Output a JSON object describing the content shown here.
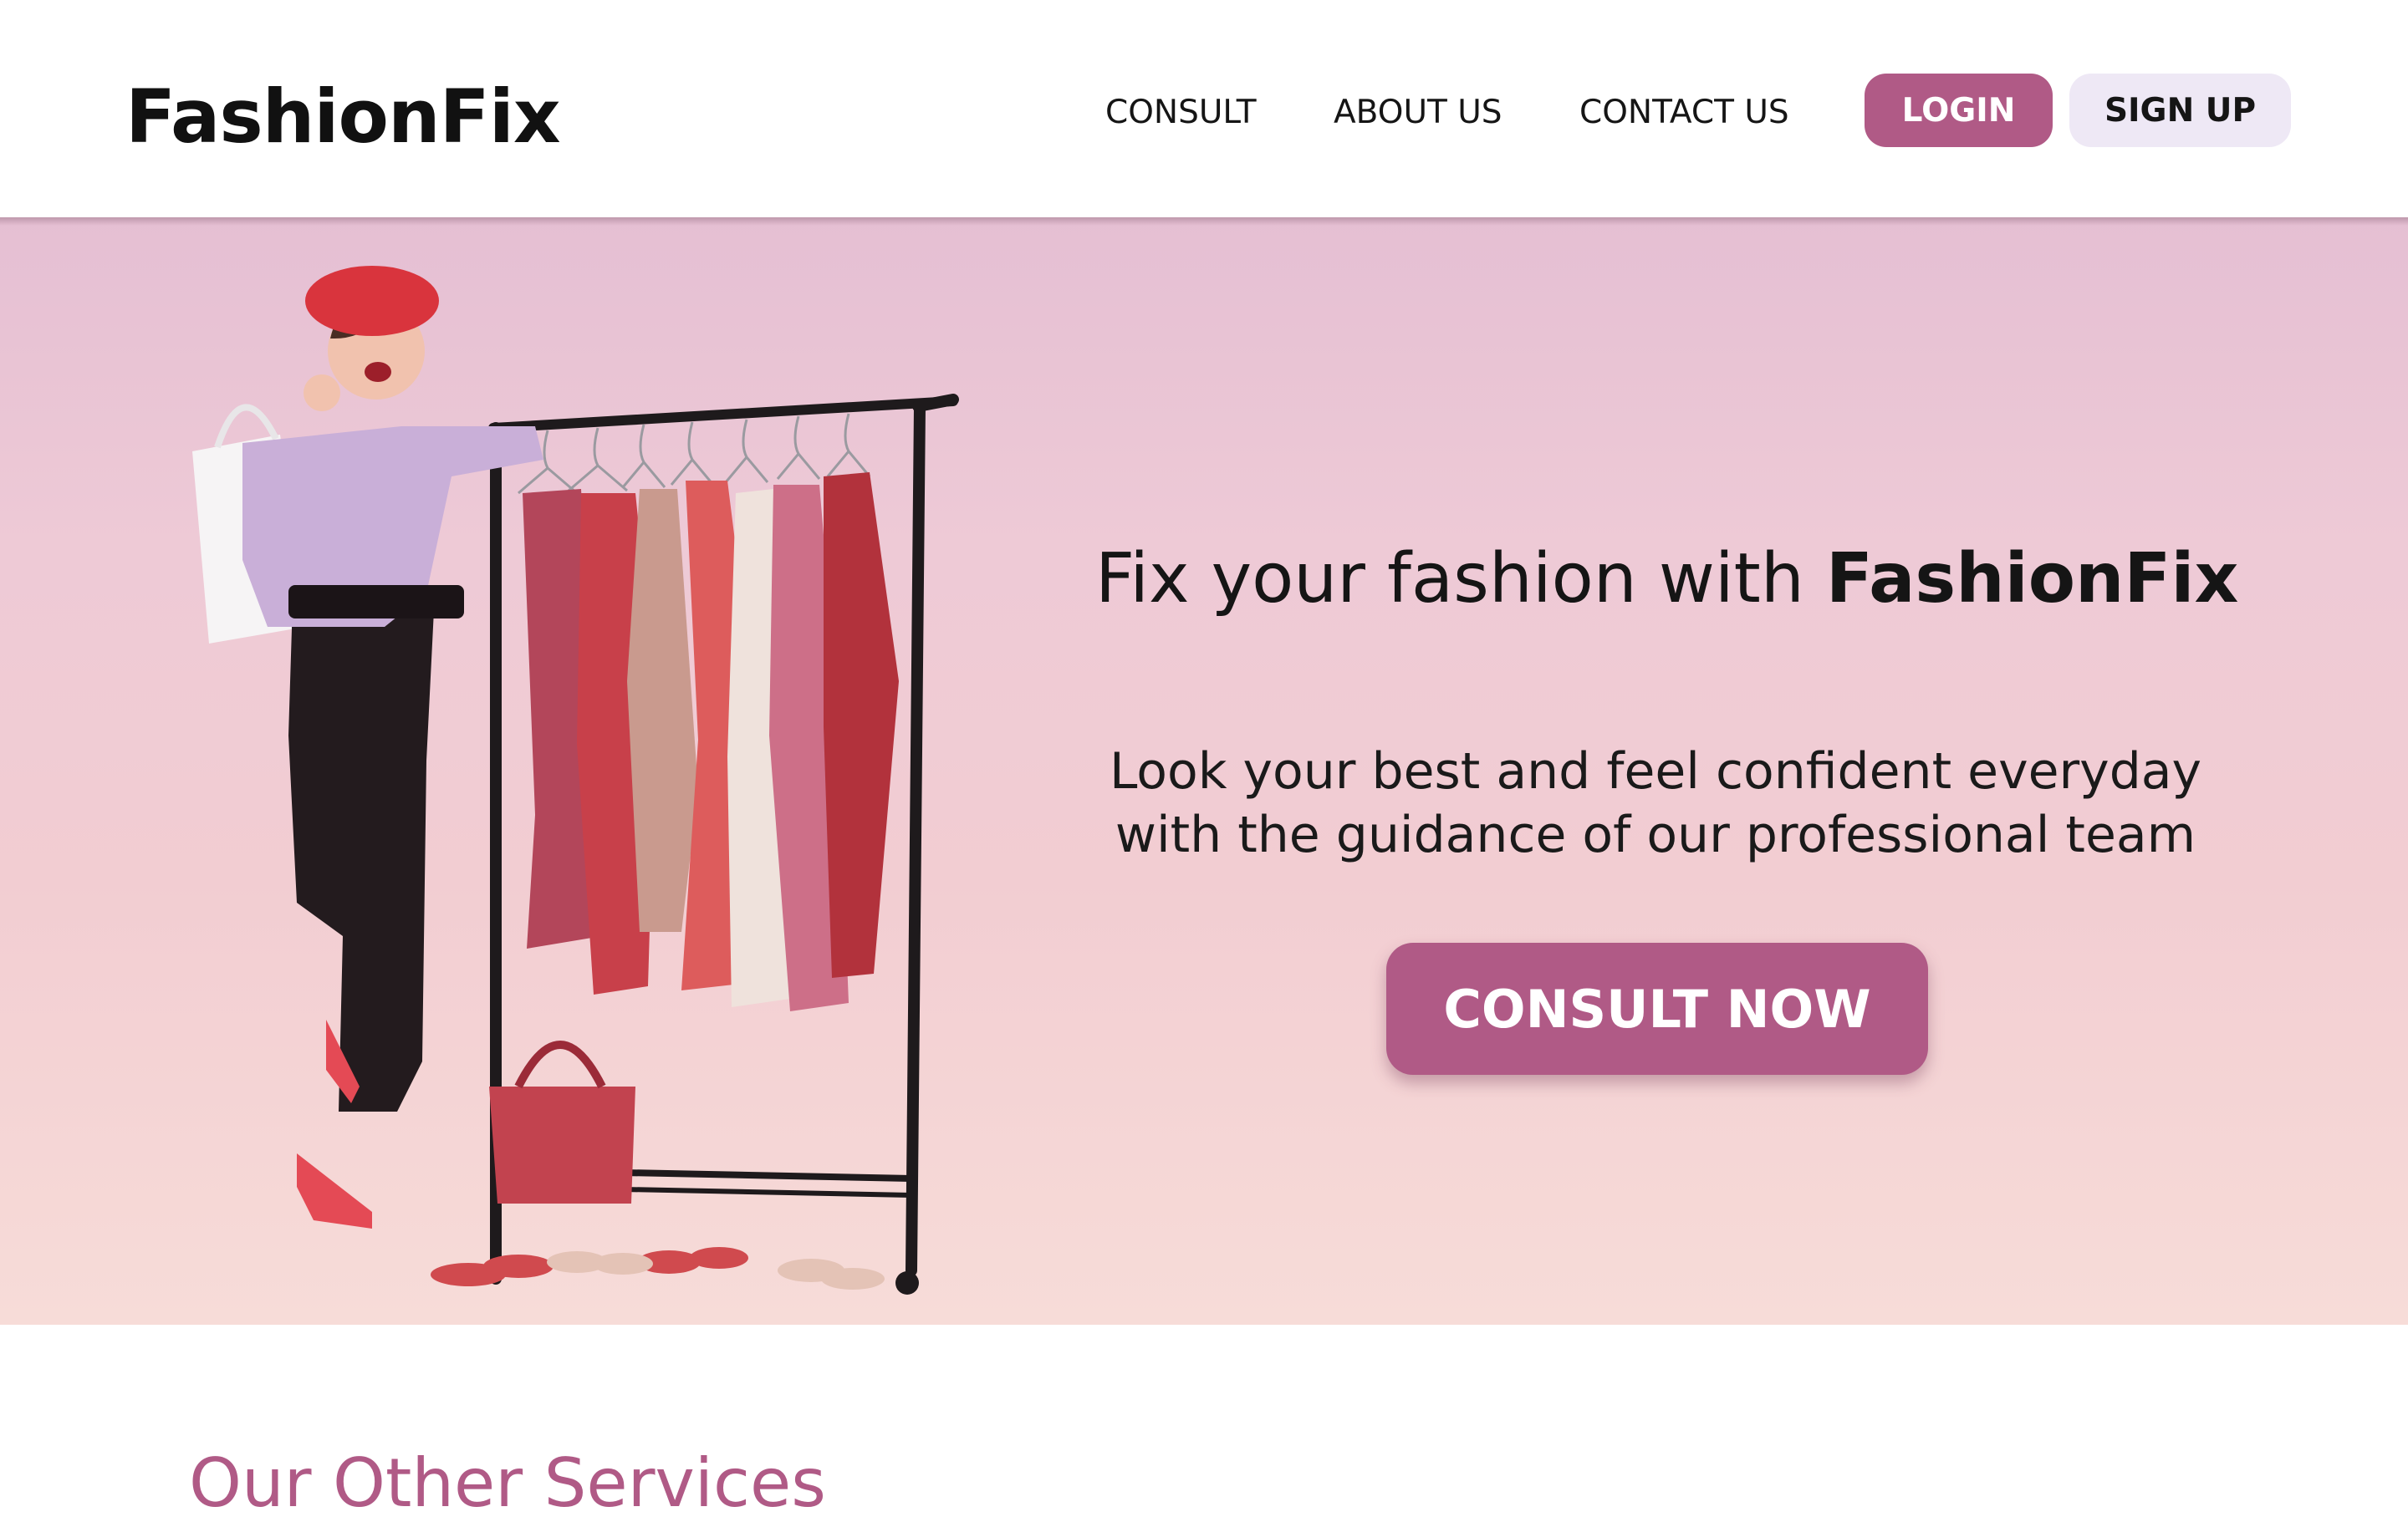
{
  "brand": {
    "name": "FashionFix"
  },
  "nav": {
    "consult": "CONSULT",
    "about": "ABOUT US",
    "contact": "CONTACT US",
    "login": "LOGIN",
    "signup": "SIGN UP"
  },
  "hero": {
    "title_prefix": "Fix your fashion with ",
    "title_brand": "FashionFix",
    "subtitle_line1": "Look your best and feel confident everyday",
    "subtitle_line2": "with the guidance of our professional team",
    "cta": "CONSULT NOW",
    "image": "woman-with-clothing-rack-image"
  },
  "services": {
    "title": "Our Other Services"
  },
  "colors": {
    "accent": "#b05a86",
    "signup_bg": "#eee8f5",
    "hero_gradient_top": "#e5bfd3",
    "hero_gradient_bottom": "#f7dcd8",
    "text": "#151515"
  }
}
